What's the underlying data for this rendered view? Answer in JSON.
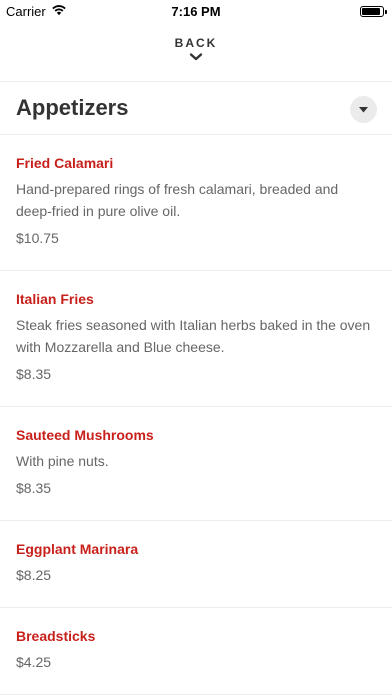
{
  "status_bar": {
    "carrier": "Carrier",
    "time": "7:16 PM",
    "battery_level": 0.9
  },
  "nav": {
    "back_label": "BACK",
    "back_icon": "chevron-down-icon"
  },
  "section": {
    "title": "Appetizers",
    "dropdown_icon": "caret-down-icon"
  },
  "colors": {
    "item_name": "#c8211c",
    "text_secondary": "#666666",
    "divider": "#ececec"
  },
  "menu": {
    "items": [
      {
        "name": "Fried Calamari",
        "description": "Hand-prepared rings of fresh calamari, breaded and deep-fried in pure olive oil.",
        "price": "$10.75"
      },
      {
        "name": "Italian Fries",
        "description": "Steak fries seasoned with Italian herbs baked in the oven with Mozzarella and Blue cheese.",
        "price": "$8.35"
      },
      {
        "name": "Sauteed Mushrooms",
        "description": "With pine nuts.",
        "price": "$8.35"
      },
      {
        "name": "Eggplant Marinara",
        "description": "",
        "price": "$8.25"
      },
      {
        "name": "Breadsticks",
        "description": "",
        "price": "$4.25"
      }
    ]
  }
}
